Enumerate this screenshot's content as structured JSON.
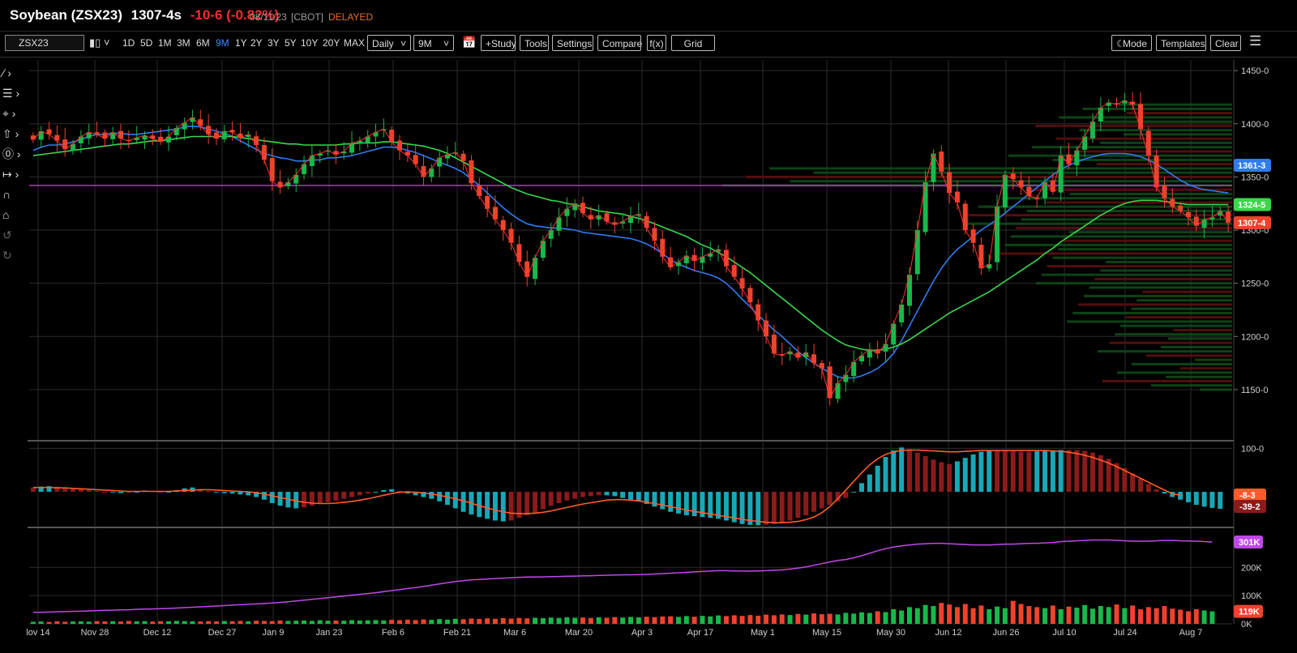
{
  "header": {
    "title": "Soybean (ZSX23)",
    "price": "1307-4s",
    "change": "-10-6 (-0.82%)",
    "date": "08/11/23",
    "exchange": "[CBOT]",
    "status": "DELAYED"
  },
  "toolbar": {
    "symbol": "ZSX23",
    "chart_type_icon": "candlestick-icon",
    "ranges": [
      "1D",
      "5D",
      "1M",
      "3M",
      "6M",
      "9M",
      "1Y",
      "2Y",
      "3Y",
      "5Y",
      "10Y",
      "20Y",
      "MAX"
    ],
    "active_range": "9M",
    "interval": "Daily",
    "period": "9M",
    "study": "+Study",
    "tools": "Tools",
    "settings": "Settings",
    "compare": "Compare",
    "fx": "f(x)",
    "grid": "Grid",
    "mode": "Mode",
    "templates": "Templates",
    "clear": "Clear"
  },
  "side_tools": [
    "line-tool-icon",
    "fib-tool-icon",
    "crosshair-tool-icon",
    "arrow-tool-icon",
    "circle-tool-icon",
    "measure-tool-icon",
    "magnet-icon",
    "lock-icon",
    "undo-icon",
    "redo-icon"
  ],
  "colors": {
    "up": "#18b84a",
    "down": "#f0422c",
    "ma_fast": "#2f7bf0",
    "ma_slow": "#38d84a",
    "hline": "#c030d0",
    "macd_pos": "#17a8b5",
    "macd_neg": "#8b1a1a",
    "oi": "#c048e8",
    "signal": "#ff5a2a"
  },
  "chart_data": [
    {
      "type": "candlestick",
      "name": "price",
      "x_labels": [
        "lov 14",
        "Nov 28",
        "Dec 12",
        "Dec 27",
        "Jan 9",
        "Jan 23",
        "Feb 6",
        "Feb 21",
        "Mar 6",
        "Mar 20",
        "Apr 3",
        "Apr 17",
        "May 1",
        "May 15",
        "May 30",
        "Jun 12",
        "Jun 26",
        "Jul 10",
        "Jul 24",
        "Aug 7"
      ],
      "y_ticks": [
        "1450-0",
        "1400-0",
        "1350-0",
        "1300-0",
        "1250-0",
        "1200-0",
        "1150-0"
      ],
      "ylim": [
        1105,
        1460
      ],
      "closes": [
        1385,
        1393,
        1390,
        1384,
        1376,
        1381,
        1388,
        1392,
        1390,
        1386,
        1392,
        1386,
        1384,
        1387,
        1389,
        1386,
        1383,
        1388,
        1396,
        1401,
        1406,
        1398,
        1390,
        1386,
        1393,
        1392,
        1387,
        1390,
        1380,
        1366,
        1346,
        1340,
        1345,
        1352,
        1362,
        1370,
        1372,
        1375,
        1371,
        1374,
        1382,
        1384,
        1388,
        1392,
        1395,
        1383,
        1375,
        1370,
        1362,
        1350,
        1358,
        1368,
        1371,
        1373,
        1365,
        1344,
        1332,
        1320,
        1310,
        1300,
        1288,
        1270,
        1256,
        1274,
        1290,
        1300,
        1312,
        1320,
        1325,
        1316,
        1310,
        1314,
        1308,
        1305,
        1308,
        1313,
        1315,
        1302,
        1290,
        1275,
        1265,
        1270,
        1276,
        1271,
        1275,
        1278,
        1282,
        1266,
        1256,
        1245,
        1232,
        1215,
        1200,
        1184,
        1182,
        1186,
        1180,
        1185,
        1175,
        1170,
        1142,
        1156,
        1164,
        1176,
        1182,
        1188,
        1184,
        1193,
        1212,
        1230,
        1258,
        1300,
        1345,
        1372,
        1355,
        1335,
        1326,
        1300,
        1288,
        1264,
        1268,
        1322,
        1352,
        1348,
        1340,
        1332,
        1330,
        1345,
        1336,
        1370,
        1362,
        1375,
        1388,
        1402,
        1415,
        1420,
        1418,
        1422,
        1418,
        1395,
        1370,
        1340,
        1330,
        1322,
        1318,
        1312,
        1304,
        1310,
        1312,
        1318,
        1307
      ],
      "lines": [
        {
          "name": "ma_fast",
          "values": [
            1375,
            1378,
            1380,
            1380,
            1381,
            1383,
            1385,
            1388,
            1390,
            1390,
            1391,
            1391,
            1390,
            1390,
            1391,
            1392,
            1393,
            1394,
            1395,
            1397,
            1398,
            1397,
            1395,
            1393,
            1391,
            1388,
            1384,
            1380,
            1376,
            1372,
            1370,
            1368,
            1367,
            1365,
            1365,
            1366,
            1366,
            1368,
            1368,
            1369,
            1370,
            1372,
            1374,
            1376,
            1378,
            1378,
            1377,
            1375,
            1373,
            1370,
            1367,
            1364,
            1361,
            1358,
            1354,
            1348,
            1342,
            1335,
            1328,
            1321,
            1315,
            1310,
            1306,
            1304,
            1303,
            1302,
            1302,
            1301,
            1300,
            1298,
            1297,
            1296,
            1295,
            1294,
            1293,
            1292,
            1290,
            1287,
            1283,
            1278,
            1272,
            1268,
            1265,
            1262,
            1260,
            1258,
            1255,
            1250,
            1243,
            1235,
            1228,
            1220,
            1213,
            1206,
            1200,
            1193,
            1186,
            1180,
            1175,
            1170,
            1166,
            1162,
            1161,
            1161,
            1163,
            1166,
            1170,
            1176,
            1184,
            1196,
            1210,
            1224,
            1238,
            1252,
            1264,
            1274,
            1282,
            1288,
            1294,
            1300,
            1305,
            1310,
            1316,
            1322,
            1328,
            1334,
            1340,
            1346,
            1352,
            1357,
            1361,
            1364,
            1367,
            1369,
            1371,
            1372,
            1372,
            1372,
            1371,
            1369,
            1366,
            1362,
            1357,
            1352,
            1347,
            1343,
            1340,
            1338,
            1337,
            1336,
            1335
          ]
        },
        {
          "name": "ma_slow",
          "values": [
            1370,
            1371,
            1372,
            1373,
            1374,
            1375,
            1376,
            1377,
            1378,
            1379,
            1380,
            1381,
            1381,
            1382,
            1383,
            1384,
            1384,
            1385,
            1386,
            1387,
            1388,
            1388,
            1388,
            1388,
            1388,
            1388,
            1387,
            1386,
            1385,
            1384,
            1383,
            1382,
            1381,
            1381,
            1380,
            1380,
            1380,
            1380,
            1380,
            1381,
            1381,
            1382,
            1382,
            1382,
            1383,
            1383,
            1382,
            1381,
            1380,
            1379,
            1377,
            1375,
            1372,
            1368,
            1364,
            1360,
            1356,
            1352,
            1348,
            1344,
            1340,
            1337,
            1334,
            1332,
            1330,
            1328,
            1327,
            1325,
            1324,
            1322,
            1320,
            1318,
            1317,
            1316,
            1315,
            1313,
            1311,
            1309,
            1306,
            1303,
            1300,
            1297,
            1294,
            1290,
            1286,
            1283,
            1279,
            1275,
            1270,
            1265,
            1260,
            1254,
            1248,
            1242,
            1236,
            1230,
            1224,
            1218,
            1212,
            1206,
            1201,
            1196,
            1192,
            1190,
            1188,
            1187,
            1187,
            1188,
            1190,
            1193,
            1197,
            1202,
            1207,
            1212,
            1217,
            1222,
            1226,
            1230,
            1234,
            1238,
            1242,
            1247,
            1252,
            1257,
            1262,
            1267,
            1272,
            1278,
            1283,
            1289,
            1294,
            1299,
            1304,
            1309,
            1314,
            1318,
            1322,
            1325,
            1327,
            1328,
            1328,
            1328,
            1327,
            1326,
            1325,
            1324,
            1324,
            1324,
            1324,
            1324,
            1324
          ]
        }
      ],
      "hline": 1342,
      "current_labels": [
        {
          "text": "1361-3",
          "value": 1361
        },
        {
          "text": "1324-5",
          "value": 1324
        },
        {
          "text": "1307-4",
          "value": 1307
        }
      ],
      "volume_profile": true
    },
    {
      "type": "histogram+line",
      "name": "macd",
      "y_ticks": [
        "100-0"
      ],
      "ylim": [
        -80,
        110
      ],
      "labels": [
        "-8-3",
        "-39-2"
      ],
      "histogram": [
        10,
        12,
        13,
        12,
        10,
        8,
        6,
        4,
        2,
        0,
        -2,
        -3,
        -2,
        0,
        3,
        2,
        0,
        -1,
        4,
        8,
        10,
        6,
        2,
        -1,
        -3,
        -4,
        -6,
        -8,
        -12,
        -18,
        -26,
        -32,
        -36,
        -38,
        -36,
        -32,
        -28,
        -24,
        -20,
        -16,
        -12,
        -8,
        -4,
        0,
        4,
        6,
        2,
        -4,
        -8,
        -12,
        -16,
        -22,
        -30,
        -38,
        -46,
        -52,
        -58,
        -62,
        -66,
        -68,
        -66,
        -60,
        -54,
        -48,
        -40,
        -32,
        -26,
        -20,
        -16,
        -12,
        -10,
        -8,
        -8,
        -10,
        -14,
        -18,
        -22,
        -28,
        -34,
        -40,
        -46,
        -50,
        -54,
        -56,
        -58,
        -60,
        -62,
        -66,
        -70,
        -74,
        -76,
        -77,
        -76,
        -74,
        -70,
        -66,
        -60,
        -54,
        -46,
        -38,
        -30,
        -22,
        -14,
        0,
        20,
        40,
        60,
        80,
        95,
        102,
        98,
        90,
        82,
        74,
        68,
        64,
        70,
        78,
        86,
        92,
        96,
        95,
        94,
        93,
        92,
        92,
        93,
        94,
        95,
        96,
        96,
        96,
        94,
        90,
        84,
        76,
        66,
        54,
        42,
        30,
        18,
        6,
        -4,
        -12,
        -18,
        -24,
        -30,
        -34,
        -37,
        -39
      ],
      "signal": [
        10,
        10,
        10,
        9,
        9,
        8,
        7,
        6,
        5,
        4,
        3,
        2,
        1,
        1,
        1,
        1,
        1,
        1,
        2,
        3,
        4,
        5,
        5,
        4,
        3,
        2,
        1,
        0,
        -2,
        -5,
        -9,
        -13,
        -17,
        -21,
        -24,
        -26,
        -27,
        -27,
        -26,
        -24,
        -22,
        -19,
        -16,
        -12,
        -8,
        -4,
        -1,
        0,
        -1,
        -3,
        -5,
        -8,
        -12,
        -16,
        -21,
        -26,
        -32,
        -37,
        -42,
        -46,
        -49,
        -50,
        -50,
        -49,
        -47,
        -44,
        -40,
        -36,
        -32,
        -28,
        -25,
        -22,
        -19,
        -18,
        -18,
        -19,
        -21,
        -24,
        -27,
        -30,
        -34,
        -38,
        -42,
        -45,
        -48,
        -51,
        -54,
        -57,
        -60,
        -63,
        -66,
        -68,
        -70,
        -71,
        -71,
        -70,
        -68,
        -64,
        -58,
        -48,
        -34,
        -16,
        4,
        24,
        44,
        62,
        76,
        86,
        92,
        95,
        96,
        96,
        95,
        94,
        93,
        92,
        92,
        93,
        94,
        95,
        95,
        95,
        95,
        95,
        95,
        95,
        95,
        95,
        94,
        93,
        91,
        88,
        84,
        79,
        73,
        66,
        58,
        49,
        40,
        31,
        22,
        13,
        4,
        -4,
        -8
      ]
    },
    {
      "type": "bar+line",
      "name": "volume_oi",
      "y_ticks": [
        "200K",
        "100K",
        "0K"
      ],
      "ylim": [
        0,
        330
      ],
      "labels": [
        "301K",
        "119K"
      ],
      "volume": [
        20,
        22,
        18,
        25,
        20,
        22,
        24,
        21,
        26,
        23,
        25,
        22,
        28,
        24,
        26,
        22,
        25,
        24,
        28,
        26,
        24,
        22,
        26,
        24,
        27,
        25,
        28,
        24,
        30,
        28,
        26,
        32,
        28,
        30,
        32,
        28,
        34,
        30,
        32,
        30,
        35,
        32,
        34,
        36,
        33,
        38,
        35,
        40,
        36,
        42,
        38,
        45,
        40,
        48,
        44,
        50,
        46,
        52,
        48,
        55,
        50,
        56,
        52,
        58,
        54,
        60,
        56,
        62,
        58,
        60,
        56,
        62,
        58,
        64,
        60,
        66,
        62,
        68,
        64,
        70,
        72,
        66,
        74,
        68,
        76,
        70,
        80,
        74,
        82,
        76,
        84,
        78,
        88,
        82,
        90,
        84,
        95,
        88,
        100,
        92,
        96,
        90,
        105,
        98,
        110,
        104,
        120,
        112,
        140,
        128,
        160,
        150,
        180,
        170,
        200,
        185,
        160,
        190,
        150,
        175,
        140,
        165,
        150,
        220,
        190,
        170,
        160,
        150,
        175,
        140,
        165,
        155,
        180,
        145,
        170,
        160,
        185,
        150,
        175,
        140,
        160,
        150,
        170,
        145,
        135,
        120,
        140,
        128,
        119
      ],
      "oi": [
        55,
        56,
        57,
        58,
        59,
        60,
        61,
        62,
        64,
        65,
        66,
        67,
        68,
        70,
        71,
        72,
        73,
        74,
        76,
        78,
        80,
        82,
        84,
        86,
        88,
        90,
        92,
        94,
        96,
        98,
        100,
        103,
        106,
        110,
        114,
        118,
        122,
        126,
        130,
        134,
        138,
        142,
        146,
        150,
        155,
        160,
        165,
        170,
        175,
        180,
        186,
        192,
        198,
        204,
        208,
        212,
        214,
        216,
        218,
        220,
        222,
        224,
        225,
        226,
        226,
        227,
        228,
        229,
        230,
        231,
        232,
        233,
        234,
        235,
        236,
        236,
        237,
        238,
        240,
        242,
        244,
        246,
        248,
        250,
        252,
        254,
        256,
        256,
        255,
        254,
        254,
        255,
        256,
        258,
        260,
        264,
        268,
        274,
        282,
        290,
        298,
        305,
        310,
        318,
        328,
        340,
        352,
        362,
        370,
        376,
        380,
        384,
        386,
        388,
        388,
        386,
        384,
        382,
        380,
        380,
        380,
        382,
        384,
        384,
        386,
        388,
        388,
        390,
        392,
        396,
        398,
        400,
        402,
        404,
        404,
        404,
        402,
        400,
        398,
        398,
        398,
        400,
        402,
        402,
        400,
        399,
        398,
        396,
        394
      ]
    }
  ]
}
